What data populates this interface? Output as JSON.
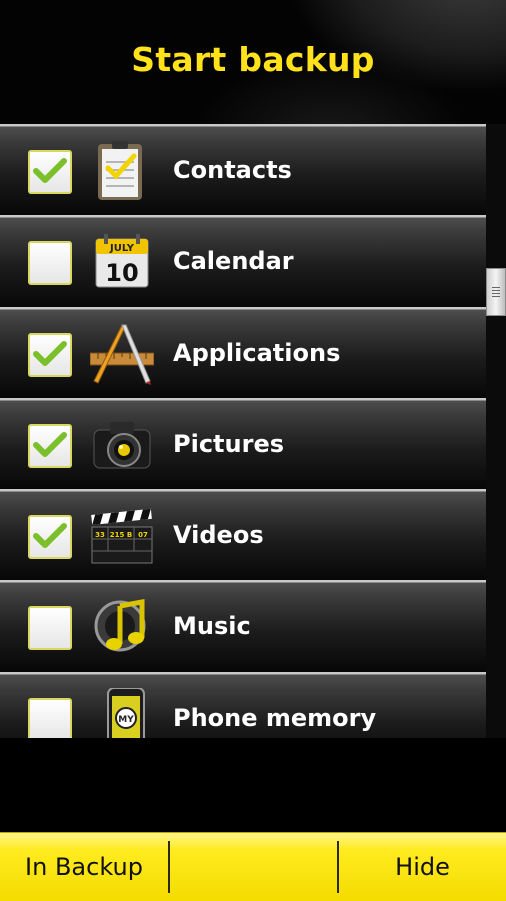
{
  "header": {
    "title": "Start backup"
  },
  "list": {
    "items": [
      {
        "label": "Contacts",
        "checked": true,
        "icon": "clipboard-icon"
      },
      {
        "label": "Calendar",
        "checked": false,
        "icon": "calendar-icon"
      },
      {
        "label": "Applications",
        "checked": true,
        "icon": "applications-pencil-ruler-icon"
      },
      {
        "label": "Pictures",
        "checked": true,
        "icon": "camera-icon"
      },
      {
        "label": "Videos",
        "checked": true,
        "icon": "clapperboard-icon"
      },
      {
        "label": "Music",
        "checked": false,
        "icon": "music-note-icon"
      },
      {
        "label": "Phone memory",
        "checked": false,
        "icon": "phone-memory-icon"
      }
    ]
  },
  "icons": {
    "calendar_month": "JULY",
    "calendar_day": "10",
    "phone_badge": "MY",
    "clapper_values": [
      "33",
      "215 B",
      "07"
    ]
  },
  "bottom_bar": {
    "left_label": "In Backup",
    "right_label": "Hide"
  },
  "colors": {
    "accent": "#ffe21a",
    "check": "#7bbf2a",
    "bar": "#ffeb1f"
  }
}
